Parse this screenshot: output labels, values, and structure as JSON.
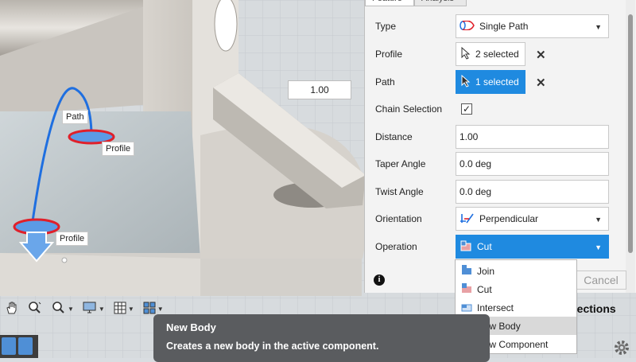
{
  "viewport": {
    "labels": {
      "path": "Path",
      "profile_top": "Profile",
      "profile_bottom": "Profile"
    },
    "distance_value": "1.00"
  },
  "dialog": {
    "tabs": {
      "feature": "Feature",
      "analysis": "Analysis"
    },
    "rows": {
      "type": {
        "label": "Type",
        "value": "Single Path",
        "icon": "single-path-icon"
      },
      "profile": {
        "label": "Profile",
        "value": "2 selected"
      },
      "path": {
        "label": "Path",
        "value": "1 selected"
      },
      "chain": {
        "label": "Chain Selection",
        "checked": true
      },
      "distance": {
        "label": "Distance",
        "value": "1.00"
      },
      "taper": {
        "label": "Taper Angle",
        "value": "0.0 deg"
      },
      "twist": {
        "label": "Twist Angle",
        "value": "0.0 deg"
      },
      "orientation": {
        "label": "Orientation",
        "value": "Perpendicular"
      },
      "operation": {
        "label": "Operation",
        "value": "Cut"
      }
    },
    "cancel": "Cancel",
    "info": "i"
  },
  "operation_menu": [
    {
      "label": "Join",
      "icon": "join-icon"
    },
    {
      "label": "Cut",
      "icon": "cut-icon"
    },
    {
      "label": "Intersect",
      "icon": "intersect-icon"
    },
    {
      "label": "New Body",
      "icon": "new-body-icon"
    },
    {
      "label": "New Component",
      "icon": "new-component-icon"
    }
  ],
  "tooltip": {
    "title": "New Body",
    "description": "Creates a new body in the active component."
  },
  "status": {
    "selections_text": "elections"
  },
  "colors": {
    "accent": "#1f8ae0",
    "path_curve": "#1f6fe0",
    "profile_red": "#e0202a"
  }
}
